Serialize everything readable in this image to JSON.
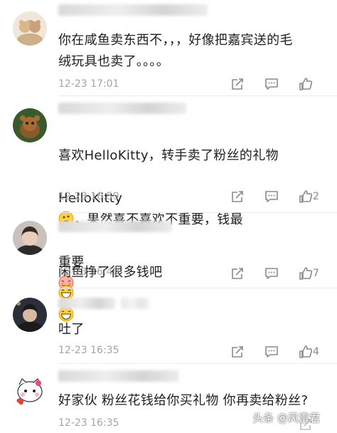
{
  "comments": [
    {
      "text": "你在咸鱼卖东西不，，，好像把嘉宾送的毛\n绒玩具也卖了。。。。",
      "time": "12-23 17:01",
      "likes": ""
    },
    {
      "text_l1": "喜欢HelloKitty，转手卖了粉丝的礼物",
      "text_l2a": "HelloKitty",
      "text_l2b": "，果然喜不喜欢不重要，钱最",
      "text_l3": "重要",
      "time": "12-23 16:59",
      "likes": "2"
    },
    {
      "text": "闲鱼挣了很多钱吧",
      "time": "12-23 16:40",
      "likes": "7"
    },
    {
      "text": "吐了",
      "time": "12-23 16:35",
      "likes": "4"
    },
    {
      "text": "好家伙 粉丝花钱给你买礼物 你再卖给粉丝?",
      "time": "12-23 16:35",
      "likes": ""
    }
  ],
  "watermark": "头条 @风雷君",
  "icons": [
    "forward-icon",
    "comment-icon",
    "like-icon",
    "thinking-emoji",
    "laugh-emoji",
    "grin-emoji"
  ],
  "colors": {
    "text": "#1f1f1f",
    "meta": "#a4a4a4",
    "icon": "#8a8a8a"
  }
}
